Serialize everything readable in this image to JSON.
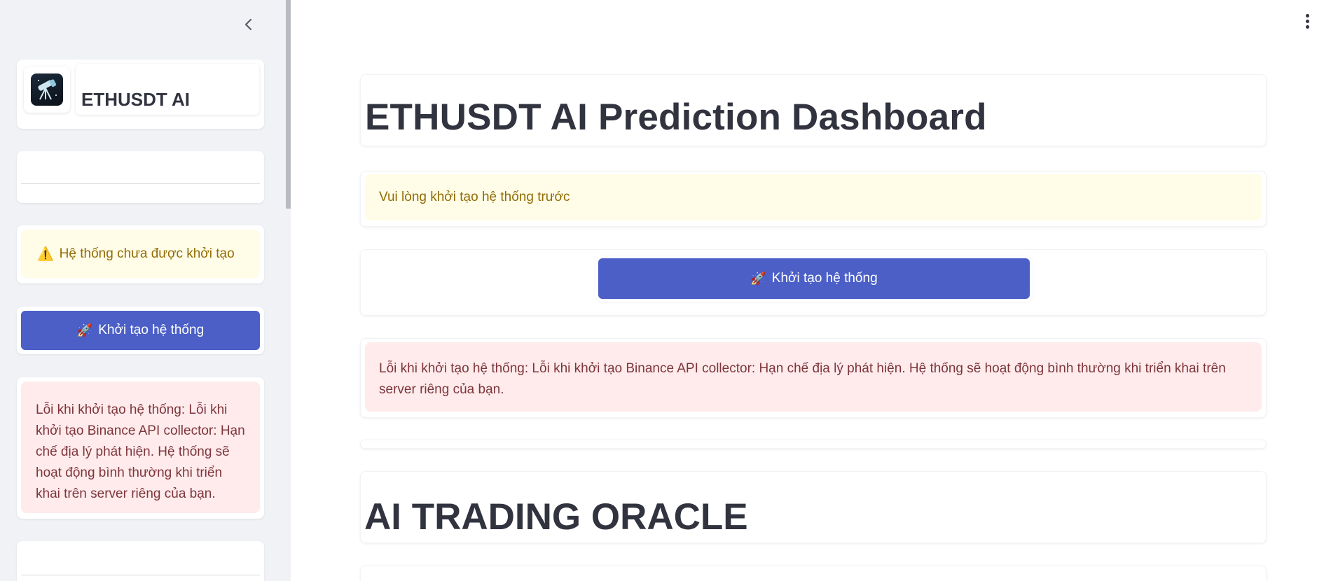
{
  "sidebar": {
    "app_title": "ETHUSDT AI",
    "status_warning": "Hệ thống chưa được khởi tạo",
    "warning_icon": "⚠️",
    "init_button_label": "Khởi tạo hệ thống",
    "rocket_icon": "🚀",
    "error_message": "Lỗi khi khởi tạo hệ thống: Lỗi khi khởi tạo Binance API collector: Hạn chế địa lý phát hiện. Hệ thống sẽ hoạt động bình thường khi triển khai trên server riêng của bạn."
  },
  "main": {
    "title": "ETHUSDT AI Prediction Dashboard",
    "info_message": "Vui lòng khởi tạo hệ thống trước",
    "init_button_label": "Khởi tạo hệ thống",
    "rocket_icon": "🚀",
    "error_message": "Lỗi khi khởi tạo hệ thống: Lỗi khi khởi tạo Binance API collector: Hạn chế địa lý phát hiện. Hệ thống sẽ hoạt động bình thường khi triển khai trên server riêng của bạn.",
    "section_title": "AI TRADING ORACLE"
  },
  "colors": {
    "primary_button": "#4b5fc7",
    "warning_bg": "#fffce7",
    "warning_text": "#926c05",
    "error_bg": "#ffebec",
    "error_text": "#7d353b",
    "sidebar_bg": "#f0f2f6"
  }
}
